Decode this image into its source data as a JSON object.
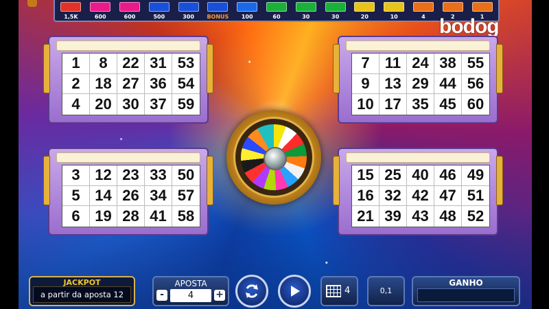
{
  "paytable": [
    {
      "value": "1,5K",
      "color": "#e0322a"
    },
    {
      "value": "600",
      "color": "#e81a8c"
    },
    {
      "value": "600",
      "color": "#e81a8c"
    },
    {
      "value": "500",
      "color": "#1a50d8"
    },
    {
      "value": "300",
      "color": "#1a50d8"
    },
    {
      "value": "BONUS",
      "color": "#1a50d8",
      "bonus": true
    },
    {
      "value": "100",
      "color": "#1a6ae8"
    },
    {
      "value": "60",
      "color": "#1ab03a"
    },
    {
      "value": "30",
      "color": "#1ab03a"
    },
    {
      "value": "30",
      "color": "#1ab03a"
    },
    {
      "value": "20",
      "color": "#e8c41a"
    },
    {
      "value": "10",
      "color": "#e8c41a"
    },
    {
      "value": "4",
      "color": "#e8701a"
    },
    {
      "value": "2",
      "color": "#e8701a"
    },
    {
      "value": "1",
      "color": "#e8701a"
    }
  ],
  "logo": "bodog",
  "cards": [
    {
      "numbers": [
        "1",
        "8",
        "22",
        "31",
        "53",
        "2",
        "18",
        "27",
        "36",
        "54",
        "4",
        "20",
        "30",
        "37",
        "59"
      ]
    },
    {
      "numbers": [
        "7",
        "11",
        "24",
        "38",
        "55",
        "9",
        "13",
        "29",
        "44",
        "56",
        "10",
        "17",
        "35",
        "45",
        "60"
      ]
    },
    {
      "numbers": [
        "3",
        "12",
        "23",
        "33",
        "50",
        "5",
        "14",
        "26",
        "34",
        "57",
        "6",
        "19",
        "28",
        "41",
        "58"
      ]
    },
    {
      "numbers": [
        "15",
        "25",
        "40",
        "46",
        "49",
        "16",
        "32",
        "42",
        "47",
        "51",
        "21",
        "39",
        "43",
        "48",
        "52"
      ]
    }
  ],
  "controls": {
    "jackpot_title": "JACKPOT",
    "jackpot_value": "a partir da aposta 12",
    "aposta_title": "APOSTA",
    "aposta_minus": "-",
    "aposta_value": "4",
    "aposta_plus": "+",
    "cards_count": "4",
    "denomination": "0,1",
    "ganho_title": "GANHO",
    "ganho_value": ""
  }
}
